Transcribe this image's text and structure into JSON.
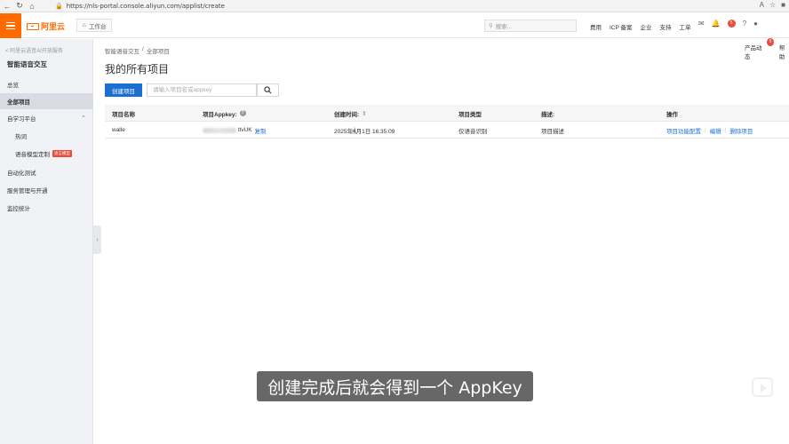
{
  "browser": {
    "url": "https://nls-portal.console.aliyun.com/applist/create"
  },
  "topnav": {
    "logo_text": "阿里云",
    "workbench_label": "工作台",
    "search_placeholder": "搜索...",
    "links": [
      "费用",
      "ICP 备案",
      "企业",
      "支持",
      "工单"
    ],
    "badge_count": "5"
  },
  "sidebar": {
    "back_label": "< 阿里云语音AI开放服务",
    "title": "智能语音交互",
    "items": [
      {
        "label": "总览"
      },
      {
        "label": "全部项目",
        "active": true
      },
      {
        "label": "自学习平台"
      },
      {
        "label": "热词"
      },
      {
        "label": "语音模型定制"
      },
      {
        "label": "自动化测试"
      },
      {
        "label": "服务管理与开通"
      },
      {
        "label": "监控统计"
      }
    ],
    "new_tag": "语言模型"
  },
  "main": {
    "breadcrumb": [
      "智能语音交互",
      "/",
      "全部项目"
    ],
    "title": "我的所有项目",
    "right_top": {
      "product_label": "产品动态",
      "product_count": "5",
      "help_label": "帮助"
    },
    "create_button": "创建项目",
    "search_placeholder": "请输入项目名或appkey",
    "table": {
      "headers": [
        "项目名称",
        "项目Appkey:",
        "创建时间:",
        "项目类型",
        "描述:",
        "操作"
      ],
      "row": {
        "name": "walle",
        "appkey_suffix": "tlvUK",
        "copy_label": "复制",
        "created": "2025年4月1日 16:35:09",
        "type": "仅语音识别",
        "desc": "项目描述",
        "actions": [
          "项目功能配置",
          "编辑",
          "删除项目"
        ]
      }
    }
  },
  "subtitle": "创建完成后就会得到一个 AppKey",
  "colors": {
    "accent": "#ff6a00",
    "primary": "#1a6fd1",
    "sidebar_bg": "#f0f2f5"
  }
}
